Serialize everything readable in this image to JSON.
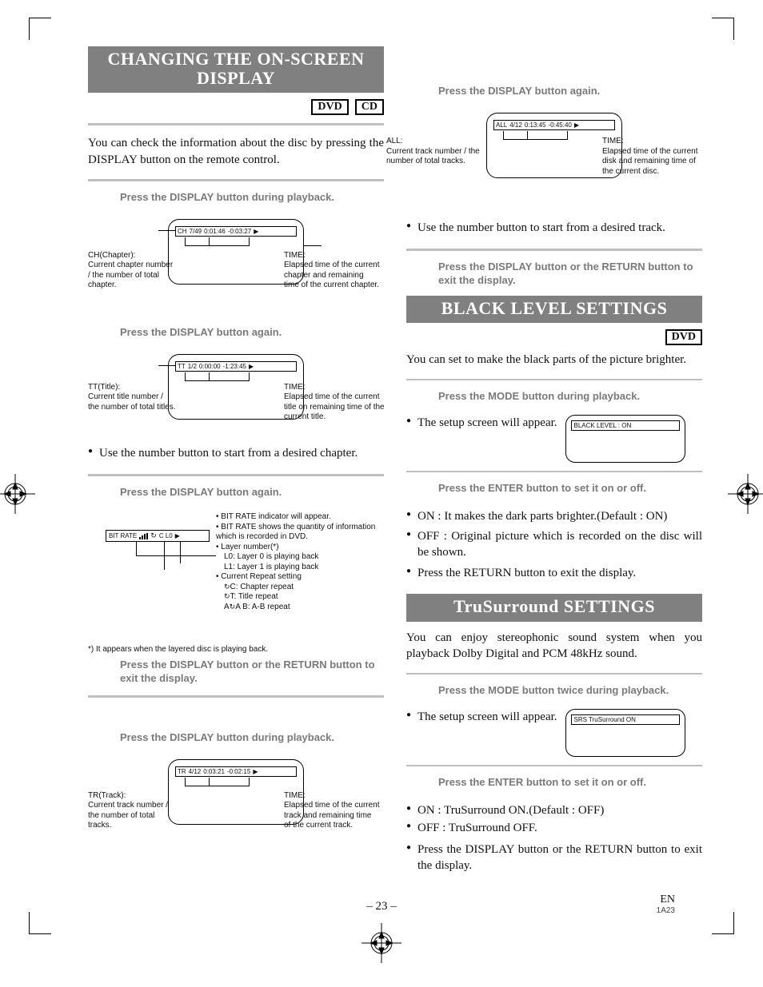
{
  "sections": {
    "changing_display": {
      "title": "CHANGING THE ON-SCREEN DISPLAY",
      "badges": [
        "DVD",
        "CD"
      ],
      "intro": "You can check the information about the disc by pressing the DISPLAY button on the remote control.",
      "step1": "Press the DISPLAY button during playback.",
      "step2": "Press the DISPLAY button again.",
      "step3": "Press the DISPLAY button again.",
      "step4": "Press the DISPLAY button or the RETURN button to exit the display.",
      "step5": "Press the DISPLAY button during playback.",
      "step6": "Press the DISPLAY button again.",
      "step7": "Press the DISPLAY button or the RETURN button to exit the display.",
      "bullet_chapter": "Use the number button to start from a desired chapter.",
      "bullet_track": "Use the number button to start from a desired track.",
      "osd1": {
        "label": "CH",
        "counter": "7/49",
        "elapsed": "0:01:46",
        "remaining": "-0:03:27"
      },
      "osd2": {
        "label": "TT",
        "counter": "1/2",
        "elapsed": "0:00:00",
        "remaining": "-1:23:45"
      },
      "osd4": {
        "label": "TR",
        "counter": "4/12",
        "elapsed": "0:03:21",
        "remaining": "-0:02:15"
      },
      "osd5": {
        "label": "ALL",
        "counter": "4/12",
        "elapsed": "0:13:45",
        "remaining": "-0:45:40"
      },
      "cap_ch_label": "CH(Chapter):",
      "cap_ch_desc": "Current chapter number / the number of total chapter.",
      "cap_ch_time_label": "TIME:",
      "cap_ch_time_desc": "Elapsed time of the current chapter and remaining time of the current chapter.",
      "cap_tt_label": "TT(Title):",
      "cap_tt_desc": "Current title number / the number of total titles.",
      "cap_tt_time_label": "TIME:",
      "cap_tt_time_desc": "Elapsed time of the current title on remaining time of the current title.",
      "cap_tr_label": "TR(Track):",
      "cap_tr_desc": "Current track number / the number of total tracks.",
      "cap_tr_time_label": "TIME:",
      "cap_tr_time_desc": "Elapsed time of the current track and remaining time of the current track.",
      "cap_all_label": "ALL:",
      "cap_all_desc": "Current track number / the number of total tracks.",
      "cap_all_time_label": "TIME:",
      "cap_all_time_desc": "Elapsed time of the current disk and remaining time of the current disc.",
      "bitrate": {
        "label": "BIT RATE",
        "extra": "C  L0",
        "line1": "• BIT RATE indicator will appear.",
        "line2": "• BIT RATE shows the quantity of information which is recorded in DVD.",
        "line3": "• Layer number(*)",
        "line3a": "L0: Layer 0 is playing back",
        "line3b": "L1: Layer 1 is playing back",
        "line4": "• Current Repeat setting",
        "line4a": "C: Chapter repeat",
        "line4b": "T: Title repeat",
        "line4c": "A   B: A-B repeat",
        "footnote": "*) It appears when the layered disc is playing back."
      }
    },
    "black_level": {
      "title": "BLACK LEVEL SETTINGS",
      "badges": [
        "DVD"
      ],
      "intro": "You can set to make the black parts of the picture brighter.",
      "step1": "Press the MODE button during playback.",
      "setup_text": "The setup screen will appear.",
      "mini_bar": "BLACK LEVEL : ON",
      "step2": "Press the ENTER button to set it on or off.",
      "bullet_on": "ON : It makes the dark parts brighter.(Default : ON)",
      "bullet_off": "OFF : Original picture which is recorded on the disc will be shown.",
      "bullet_exit": "Press the RETURN button to exit the display."
    },
    "trusurround": {
      "title": "TruSurround SETTINGS",
      "intro": "You can enjoy stereophonic sound system when you playback Dolby Digital and PCM 48kHz sound.",
      "step1": "Press the MODE button twice during playback.",
      "setup_text": "The setup screen will appear.",
      "mini_bar": "SRS TruSurround ON",
      "step2": "Press the ENTER button to set it on or off.",
      "line_on": "ON : TruSurround ON.(Default : OFF)",
      "line_off": "OFF : TruSurround OFF.",
      "bullet_exit": "Press the DISPLAY button or the RETURN button to exit the display."
    }
  },
  "footer": {
    "page": "23",
    "lang": "EN",
    "code": "1A23"
  }
}
